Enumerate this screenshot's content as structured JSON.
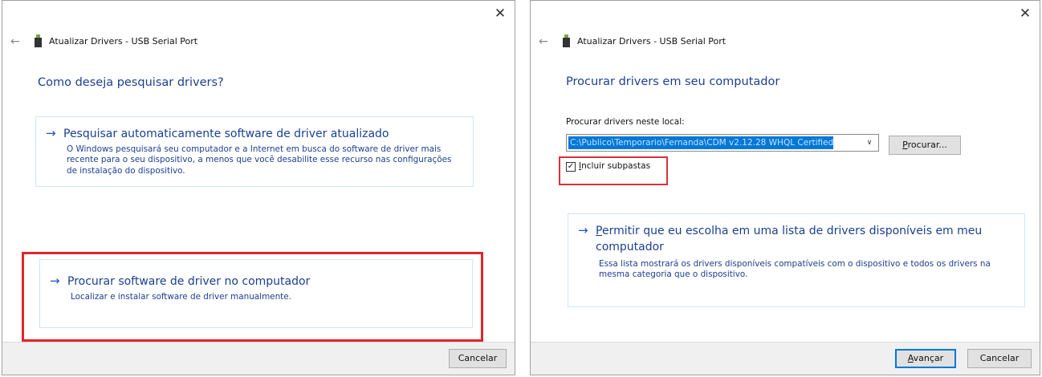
{
  "left_window": {
    "title": "Atualizar Drivers - USB Serial Port",
    "close_glyph": "✕",
    "back_glyph": "←",
    "heading": "Como deseja pesquisar drivers?",
    "option_auto": {
      "arrow": "→",
      "title": "Pesquisar automaticamente software de driver atualizado",
      "desc_line1": "O Windows pesquisará seu computador e a Internet em busca do software de driver mais",
      "desc_line2": "recente para o seu dispositivo, a menos que você desabilite esse recurso nas configurações",
      "desc_line3": "de instalação do dispositivo."
    },
    "option_browse": {
      "arrow": "→",
      "title": "Procurar software de driver no computador",
      "desc": "Localizar e instalar software de driver manualmente."
    },
    "cancel_label": "Cancelar"
  },
  "right_window": {
    "title": "Atualizar Drivers - USB Serial Port",
    "close_glyph": "✕",
    "back_glyph": "←",
    "heading": "Procurar drivers em seu computador",
    "location_label": "Procurar drivers neste local:",
    "path_value": "C:\\Publico\\Temporario\\Fernanda\\CDM v2.12.28 WHQL Certified",
    "browse_label_u": "P",
    "browse_label_rest": "rocurar...",
    "include_subfolders_u": "I",
    "include_subfolders_rest": "ncluir subpastas",
    "include_subfolders_checked": true,
    "check_glyph": "✓",
    "option_pick": {
      "arrow": "→",
      "title_u": "P",
      "title_line1_rest": "ermitir que eu escolha em uma lista de drivers disponíveis em meu",
      "title_line2": "computador",
      "desc_line1": "Essa lista mostrará os drivers disponíveis compatíveis com o dispositivo e todos os drivers na",
      "desc_line2": "mesma categoria que o dispositivo."
    },
    "next_label_u": "A",
    "next_label_rest": "vançar",
    "cancel_label": "Cancelar"
  },
  "colors": {
    "accent_blue": "#1b3f8f",
    "highlight_red": "#e0262a",
    "selection_blue": "#0078d7"
  }
}
